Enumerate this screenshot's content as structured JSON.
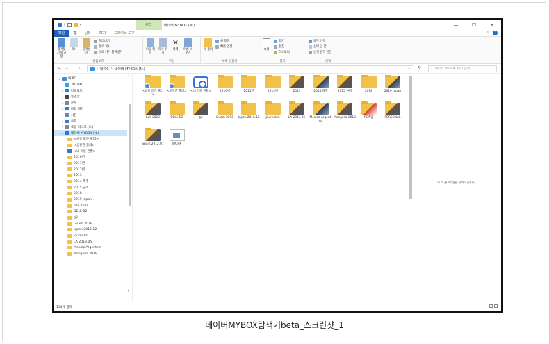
{
  "window": {
    "manage_tab": "관리",
    "title": "네이버 MYBOX (N:)",
    "controls": [
      "—",
      "☐",
      "✕"
    ]
  },
  "ribbon_tabs": [
    "파일",
    "홈",
    "공유",
    "보기",
    "드라이브 도구"
  ],
  "ribbon": {
    "clipboard": {
      "label": "클립보드",
      "pin": "즐겨찾기에 고정",
      "copy": "복사",
      "paste": "붙여넣기",
      "cut": "잘라내기",
      "copy_path": "경로 복사",
      "paste_shortcut": "바로 가기 붙여넣기"
    },
    "organize": {
      "label": "구성",
      "move_to": "이동 위치",
      "copy_to": "복사 위치",
      "delete": "삭제",
      "rename": "이름 바꾸기"
    },
    "new": {
      "label": "새로 만들기",
      "new_folder": "새 폴더",
      "new_item": "새 항목",
      "easy_access": "빠른 연결"
    },
    "open": {
      "label": "열기",
      "properties": "속성",
      "open": "열기",
      "edit": "편집",
      "history": "히스토리"
    },
    "select": {
      "label": "선택",
      "select_all": "모두 선택",
      "select_none": "선택 안 함",
      "invert": "선택 영역 반전"
    }
  },
  "address": {
    "path": [
      "내 PC",
      "네이버 MYBOX (N:)"
    ],
    "search_placeholder": "네이버 MYBOX (N:) 검색"
  },
  "nav_items": [
    {
      "label": "내 PC",
      "color": "#3a8ee6",
      "arrow": "⌄"
    },
    {
      "label": "3D 개체",
      "color": "#3aa3e6",
      "arrow": "›"
    },
    {
      "label": "다운로드",
      "color": "#2d7bd6",
      "arrow": "›"
    },
    {
      "label": "동영상",
      "color": "#444444",
      "arrow": "›"
    },
    {
      "label": "문서",
      "color": "#7a8a9a",
      "arrow": "›"
    },
    {
      "label": "바탕 화면",
      "color": "#2e7bd0",
      "arrow": "›"
    },
    {
      "label": "사진",
      "color": "#6a8aa8",
      "arrow": "›"
    },
    {
      "label": "음악",
      "color": "#2d7bd6",
      "arrow": "›"
    },
    {
      "label": "로컬 디스크 (C:)",
      "color": "#888888",
      "arrow": "›"
    },
    {
      "label": "네이버 MYBOX (N:)",
      "color": "#2f74e0",
      "arrow": "⌄",
      "selected": true
    },
    {
      "label": "<공유 받은 폴더>",
      "color": "#f2c248",
      "arrow": "›"
    },
    {
      "label": "<공유한 폴더>",
      "color": "#f2c248",
      "arrow": ""
    },
    {
      "label": "<내 이용 현황>",
      "color": "#2f74e0",
      "arrow": "›"
    },
    {
      "label": "2010년",
      "color": "#f2c248",
      "arrow": "›"
    },
    {
      "label": "2011년",
      "color": "#f2c248",
      "arrow": "›"
    },
    {
      "label": "2012년",
      "color": "#f2c248",
      "arrow": "›"
    },
    {
      "label": "2013",
      "color": "#f2c248",
      "arrow": ""
    },
    {
      "label": "2014 제주",
      "color": "#f2c248",
      "arrow": ""
    },
    {
      "label": "2015 남미",
      "color": "#f2c248",
      "arrow": ""
    },
    {
      "label": "2018",
      "color": "#f2c248",
      "arrow": ""
    },
    {
      "label": "2019 Japan",
      "color": "#f2c248",
      "arrow": ""
    },
    {
      "label": "bali 2019",
      "color": "#f2c248",
      "arrow": ""
    },
    {
      "label": "DELE B2",
      "color": "#f2c248",
      "arrow": "›"
    },
    {
      "label": "g3",
      "color": "#f2c248",
      "arrow": ""
    },
    {
      "label": "Guam 2018",
      "color": "#f2c248",
      "arrow": ""
    },
    {
      "label": "Japan 2016.12",
      "color": "#f2c248",
      "arrow": ""
    },
    {
      "label": "Journalist",
      "color": "#f2c248",
      "arrow": "›"
    },
    {
      "label": "LA 2013.05",
      "color": "#f2c248",
      "arrow": "›"
    },
    {
      "label": "Mexico Argentina",
      "color": "#f2c248",
      "arrow": "›"
    },
    {
      "label": "Mongolia 2018",
      "color": "#f2c248",
      "arrow": "›"
    }
  ],
  "files": [
    {
      "label": "<공유 받은 폴더>",
      "icon": "shared"
    },
    {
      "label": "<공유한 폴더>",
      "icon": "shared"
    },
    {
      "label": "<내 이용 현황>",
      "icon": "naver"
    },
    {
      "label": "2010년",
      "icon": "folder"
    },
    {
      "label": "2011년",
      "icon": "folder"
    },
    {
      "label": "2012년",
      "icon": "folder"
    },
    {
      "label": "2013",
      "icon": "img"
    },
    {
      "label": "2014 제주",
      "icon": "img2"
    },
    {
      "label": "2015 남미",
      "icon": "img"
    },
    {
      "label": "2018",
      "icon": "folder"
    },
    {
      "label": "2019 Japan",
      "icon": "img2"
    },
    {
      "label": "bali 2019",
      "icon": "img"
    },
    {
      "label": "DELE B2",
      "icon": "folder"
    },
    {
      "label": "g3",
      "icon": "img"
    },
    {
      "label": "Guam 2018",
      "icon": "folder"
    },
    {
      "label": "Japan 2016.12",
      "icon": "folder"
    },
    {
      "label": "Journalist",
      "icon": "folder"
    },
    {
      "label": "LA 2013.05",
      "icon": "img"
    },
    {
      "label": "Mexico Argentina",
      "icon": "img2"
    },
    {
      "label": "Mongolia 2018",
      "icon": "img"
    },
    {
      "label": "PC백업",
      "icon": "pdf"
    },
    {
      "label": "PERSONAL",
      "icon": "img"
    },
    {
      "label": "Spain 2012.01",
      "icon": "img"
    },
    {
      "label": "WORK",
      "icon": "doc"
    }
  ],
  "preview_text": "미리 볼 파일을 선택하십시오.",
  "status": "154개 항목",
  "caption": "네이버MYBOX탐색기beta_스크린샷_1"
}
